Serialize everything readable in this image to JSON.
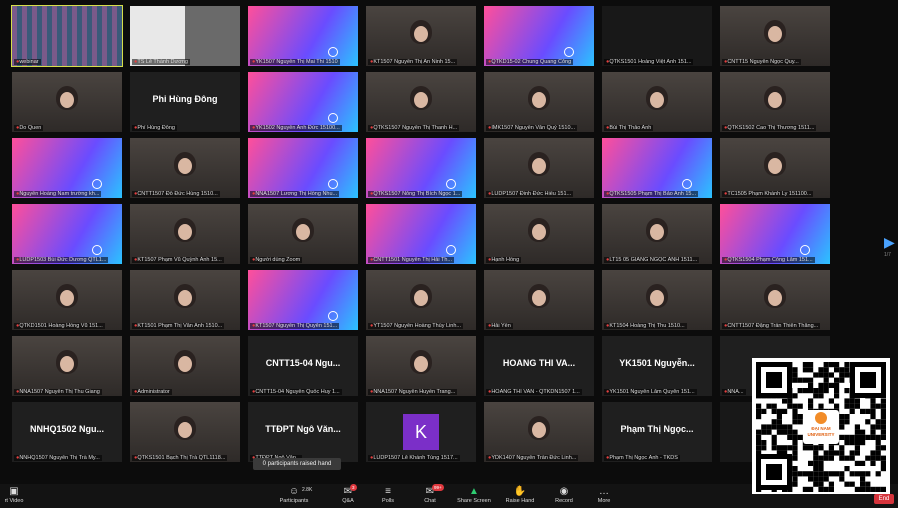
{
  "tiles": [
    {
      "label": "webinar",
      "kind": "gallery"
    },
    {
      "label": "TS Lê Thành Dương",
      "kind": "board"
    },
    {
      "label": "YK1507 Nguyễn Thị Mai Thi 1510",
      "kind": "gradient"
    },
    {
      "label": "KT1507 Nguyễn Thị An Ninh 15...",
      "kind": "face"
    },
    {
      "label": "QTKD15-02 Chung Quang Công",
      "kind": "gradient"
    },
    {
      "label": "QTKS1501 Hoàng Việt Anh 151...",
      "kind": "dark"
    },
    {
      "label": "CNTT15 Nguyễn Ngọc Quy...",
      "kind": "face"
    },
    {
      "label": "Do Quen",
      "kind": "face"
    },
    {
      "label": "Phí Hùng Đông",
      "kind": "name",
      "name": "Phi Hùng Đông"
    },
    {
      "label": "YK1502 Nguyễn Anh Đức 15100...",
      "kind": "gradient"
    },
    {
      "label": "QTKS1507 Nguyễn Thị Thanh H...",
      "kind": "face"
    },
    {
      "label": "IMK1507 Nguyễn Văn Quý 1510...",
      "kind": "face"
    },
    {
      "label": "Bùi Thị Thảo Anh",
      "kind": "face"
    },
    {
      "label": "QTKS1502 Cao Thị Thương 1511...",
      "kind": "face"
    },
    {
      "label": "Nguyễn Hoàng Nam trường kh...",
      "kind": "gradient"
    },
    {
      "label": "CNTT1507 Đỗ Đức Hùng 1510...",
      "kind": "face"
    },
    {
      "label": "NNA1507 Lương Thị Hồng Nhu...",
      "kind": "gradient"
    },
    {
      "label": "QTKS1507 Nông Thị Bích Ngọc 1...",
      "kind": "gradient"
    },
    {
      "label": "LUDP1507 Đinh Đức Hiếu 151...",
      "kind": "face"
    },
    {
      "label": "QTKS1505 Phạm Thị Bảo Anh 15...",
      "kind": "gradient"
    },
    {
      "label": "TC1505 Phạm Khánh Ly 151100...",
      "kind": "face"
    },
    {
      "label": "LUDP1503 Bùi Đức Dương QTL1...",
      "kind": "gradient"
    },
    {
      "label": "KT1507 Phạm Vũ Quỳnh Anh 15...",
      "kind": "face"
    },
    {
      "label": "Người dùng Zoom",
      "kind": "face"
    },
    {
      "label": "CNTT1501 Nguyễn Thị Hải Th...",
      "kind": "gradient"
    },
    {
      "label": "Hạnh Hồng",
      "kind": "face"
    },
    {
      "label": "LT15 05 GIANG NGỌC ANH 1511...",
      "kind": "face"
    },
    {
      "label": "QTKS1504 Phạm Công Lâm 151...",
      "kind": "gradient"
    },
    {
      "label": "QTKD1501 Hoàng Hồng Vũ 151...",
      "kind": "face"
    },
    {
      "label": "KT1501 Phạm Thị Vân Anh 1510...",
      "kind": "face"
    },
    {
      "label": "KT1507 Nguyễn Thị Quyên 151...",
      "kind": "gradient"
    },
    {
      "label": "YT1507 Nguyễn Hoàng Thùy Linh...",
      "kind": "face"
    },
    {
      "label": "Hải Yến",
      "kind": "face"
    },
    {
      "label": "KT1504 Hoàng Thị Thu 1510...",
      "kind": "face"
    },
    {
      "label": "CNTT1507 Đặng Trần Thiên Thắng...",
      "kind": "face"
    },
    {
      "label": "NNA1507 Nguyễn Thị Thu Giang",
      "kind": "face"
    },
    {
      "label": "Administrator",
      "kind": "face"
    },
    {
      "label": "CNTT15-04 Nguyễn Quốc Huy 1...",
      "kind": "name",
      "name": "CNTT15-04 Ngu..."
    },
    {
      "label": "NNA1507 Nguyễn Huyền Trang...",
      "kind": "face"
    },
    {
      "label": "HOANG THI VAN - QTKDN1507 1...",
      "kind": "name",
      "name": "HOANG THI VA..."
    },
    {
      "label": "YK1501 Nguyễn Lâm Quyên 151...",
      "kind": "name",
      "name": "YK1501 Nguyễn..."
    },
    {
      "label": "NNA...",
      "kind": "name",
      "name": "NNA"
    },
    {
      "label": "NNHQ1507 Nguyễn Thị Trà My...",
      "kind": "name",
      "name": "NNHQ1502 Ngu..."
    },
    {
      "label": "QTKS1501 Bạch Thị Trà QTL1118...",
      "kind": "face"
    },
    {
      "label": "TTĐPT Ngô Văn...",
      "kind": "name",
      "name": "TTĐPT Ngô Văn..."
    },
    {
      "label": "LUDP1507 Lê Khánh Tùng 1517...",
      "kind": "letter",
      "letter": "K"
    },
    {
      "label": "YDK1407 Nguyễn Trần Đức Linh...",
      "kind": "face"
    },
    {
      "label": "Phạm Thị Ngọc Ánh - TKDS",
      "kind": "name",
      "name": "Phạm Thị Ngọc..."
    },
    {
      "label": "",
      "kind": "dark"
    }
  ],
  "raised_hands": "0 participants raised hand",
  "page_indicator": "1/7",
  "toolbar": {
    "left": [
      {
        "icon": "video-icon",
        "label": "rt Video"
      }
    ],
    "items": [
      {
        "icon": "participants-icon",
        "label": "Participants",
        "count": "2.8K"
      },
      {
        "icon": "qa-icon",
        "label": "Q&A",
        "badge": "3"
      },
      {
        "icon": "polls-icon",
        "label": "Polls"
      },
      {
        "icon": "chat-icon",
        "label": "Chat",
        "badge": "99+"
      },
      {
        "icon": "share-screen-icon",
        "label": "Share Screen"
      },
      {
        "icon": "raise-hand-icon",
        "label": "Raise Hand"
      },
      {
        "icon": "record-icon",
        "label": "Record"
      },
      {
        "icon": "more-icon",
        "label": "More"
      }
    ],
    "end_label": "End"
  },
  "qr_logo": {
    "text": "ĐẠI NAM\nUNIVERSITY"
  },
  "colors": {
    "gradient_a": "#ff4f9a",
    "gradient_b": "#6a4cff",
    "accent_green": "#2ecc71",
    "selected_outline": "#d6e04a",
    "end_red": "#d6343c"
  }
}
